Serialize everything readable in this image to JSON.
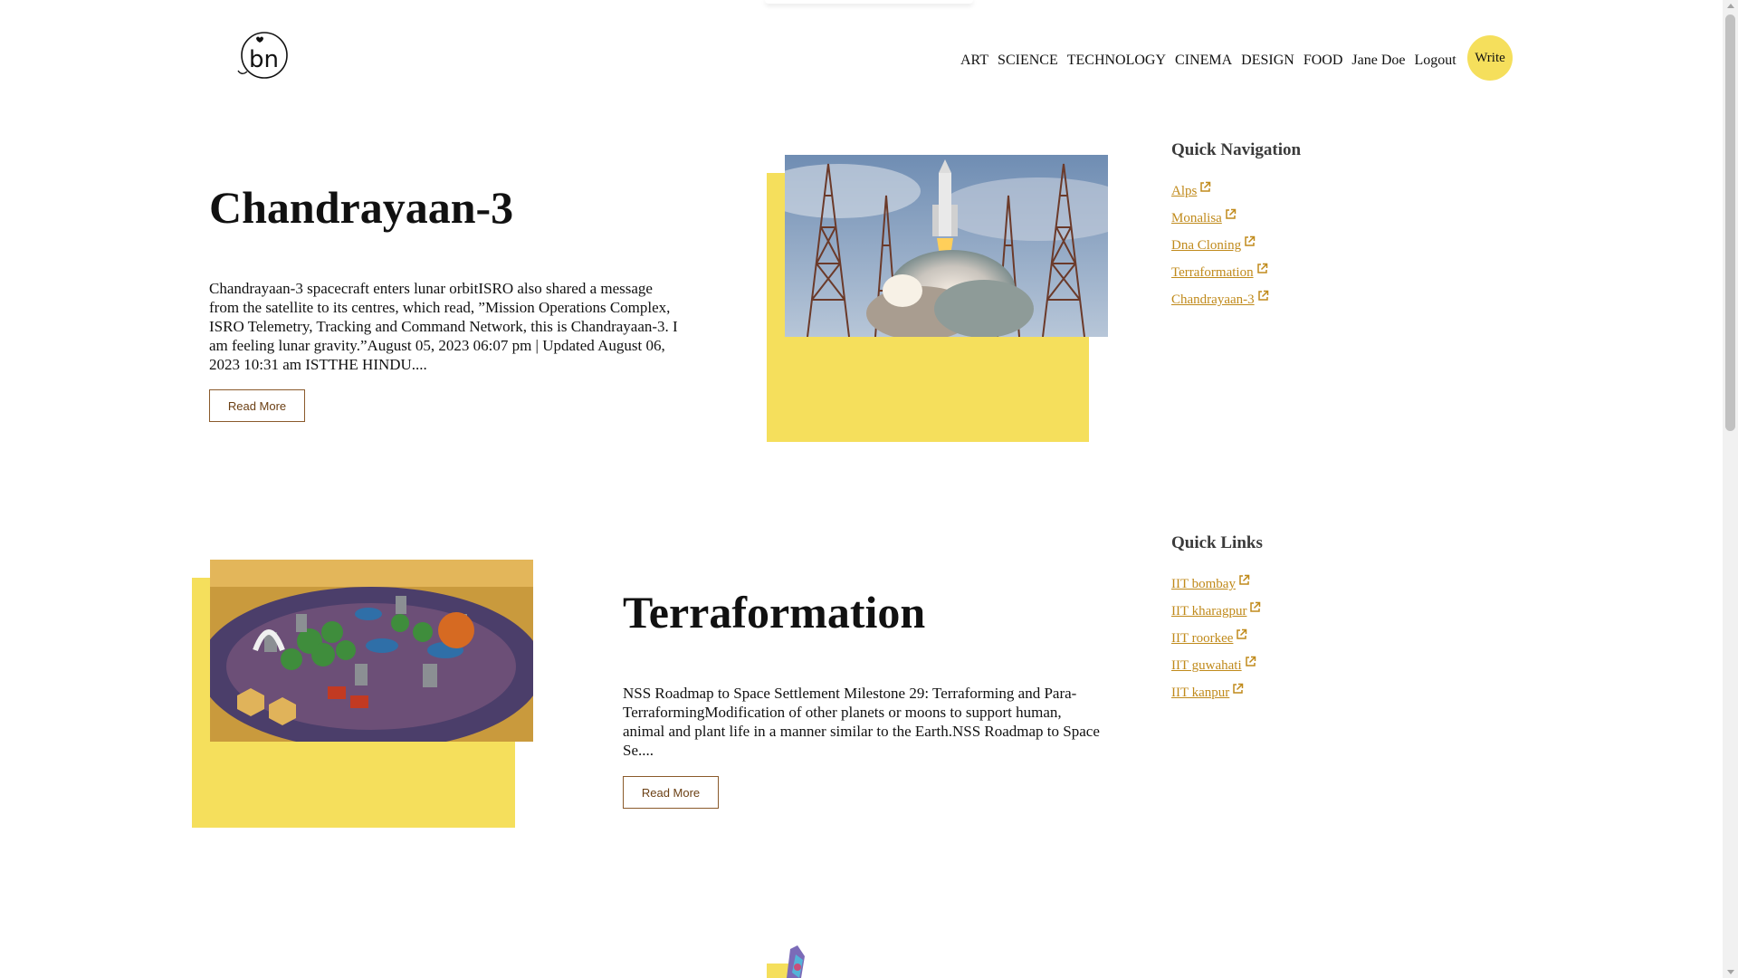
{
  "header": {
    "logo_text": "bn",
    "nav": [
      "ART",
      "SCIENCE",
      "TECHNOLOGY",
      "CINEMA",
      "DESIGN",
      "FOOD",
      "Jane Doe",
      "Logout"
    ],
    "write_label": "Write"
  },
  "posts": [
    {
      "title": "Chandrayaan-3",
      "excerpt": "Chandrayaan-3 spacecraft enters lunar orbitISRO also shared a message from the satellite to its centres, which read, ”Mission Operations Complex, ISRO Telemetry, Tracking and Command Network, this is Chandrayaan-3. I am feeling lunar gravity.”August 05, 2023 06:07 pm | Updated August 06, 2023 10:31 am ISTTHE HINDU....",
      "read_more": "Read More",
      "image": "rocket-launch-image"
    },
    {
      "title": "Terraformation",
      "excerpt": "NSS Roadmap to Space Settlement Milestone 29: Terraforming and Para-TerraformingModification of other planets or moons to support human, animal and plant life in a manner similar to the Earth.NSS Roadmap to Space Se....",
      "read_more": "Read More",
      "image": "board-game-image"
    }
  ],
  "sidebar": {
    "quick_navigation": {
      "title": "Quick Navigation",
      "links": [
        "Alps",
        "Monalisa",
        "Dna Cloning",
        "Terraformation",
        "Chandrayaan-3"
      ]
    },
    "quick_links": {
      "title": "Quick Links",
      "links": [
        "IIT bombay",
        "IIT kharagpur",
        "IIT roorkee",
        "IIT guwahati",
        "IIT kanpur"
      ]
    }
  },
  "colors": {
    "accent": "#f5df5c",
    "link": "#c08a1b",
    "button_border": "#8a5a2b"
  }
}
